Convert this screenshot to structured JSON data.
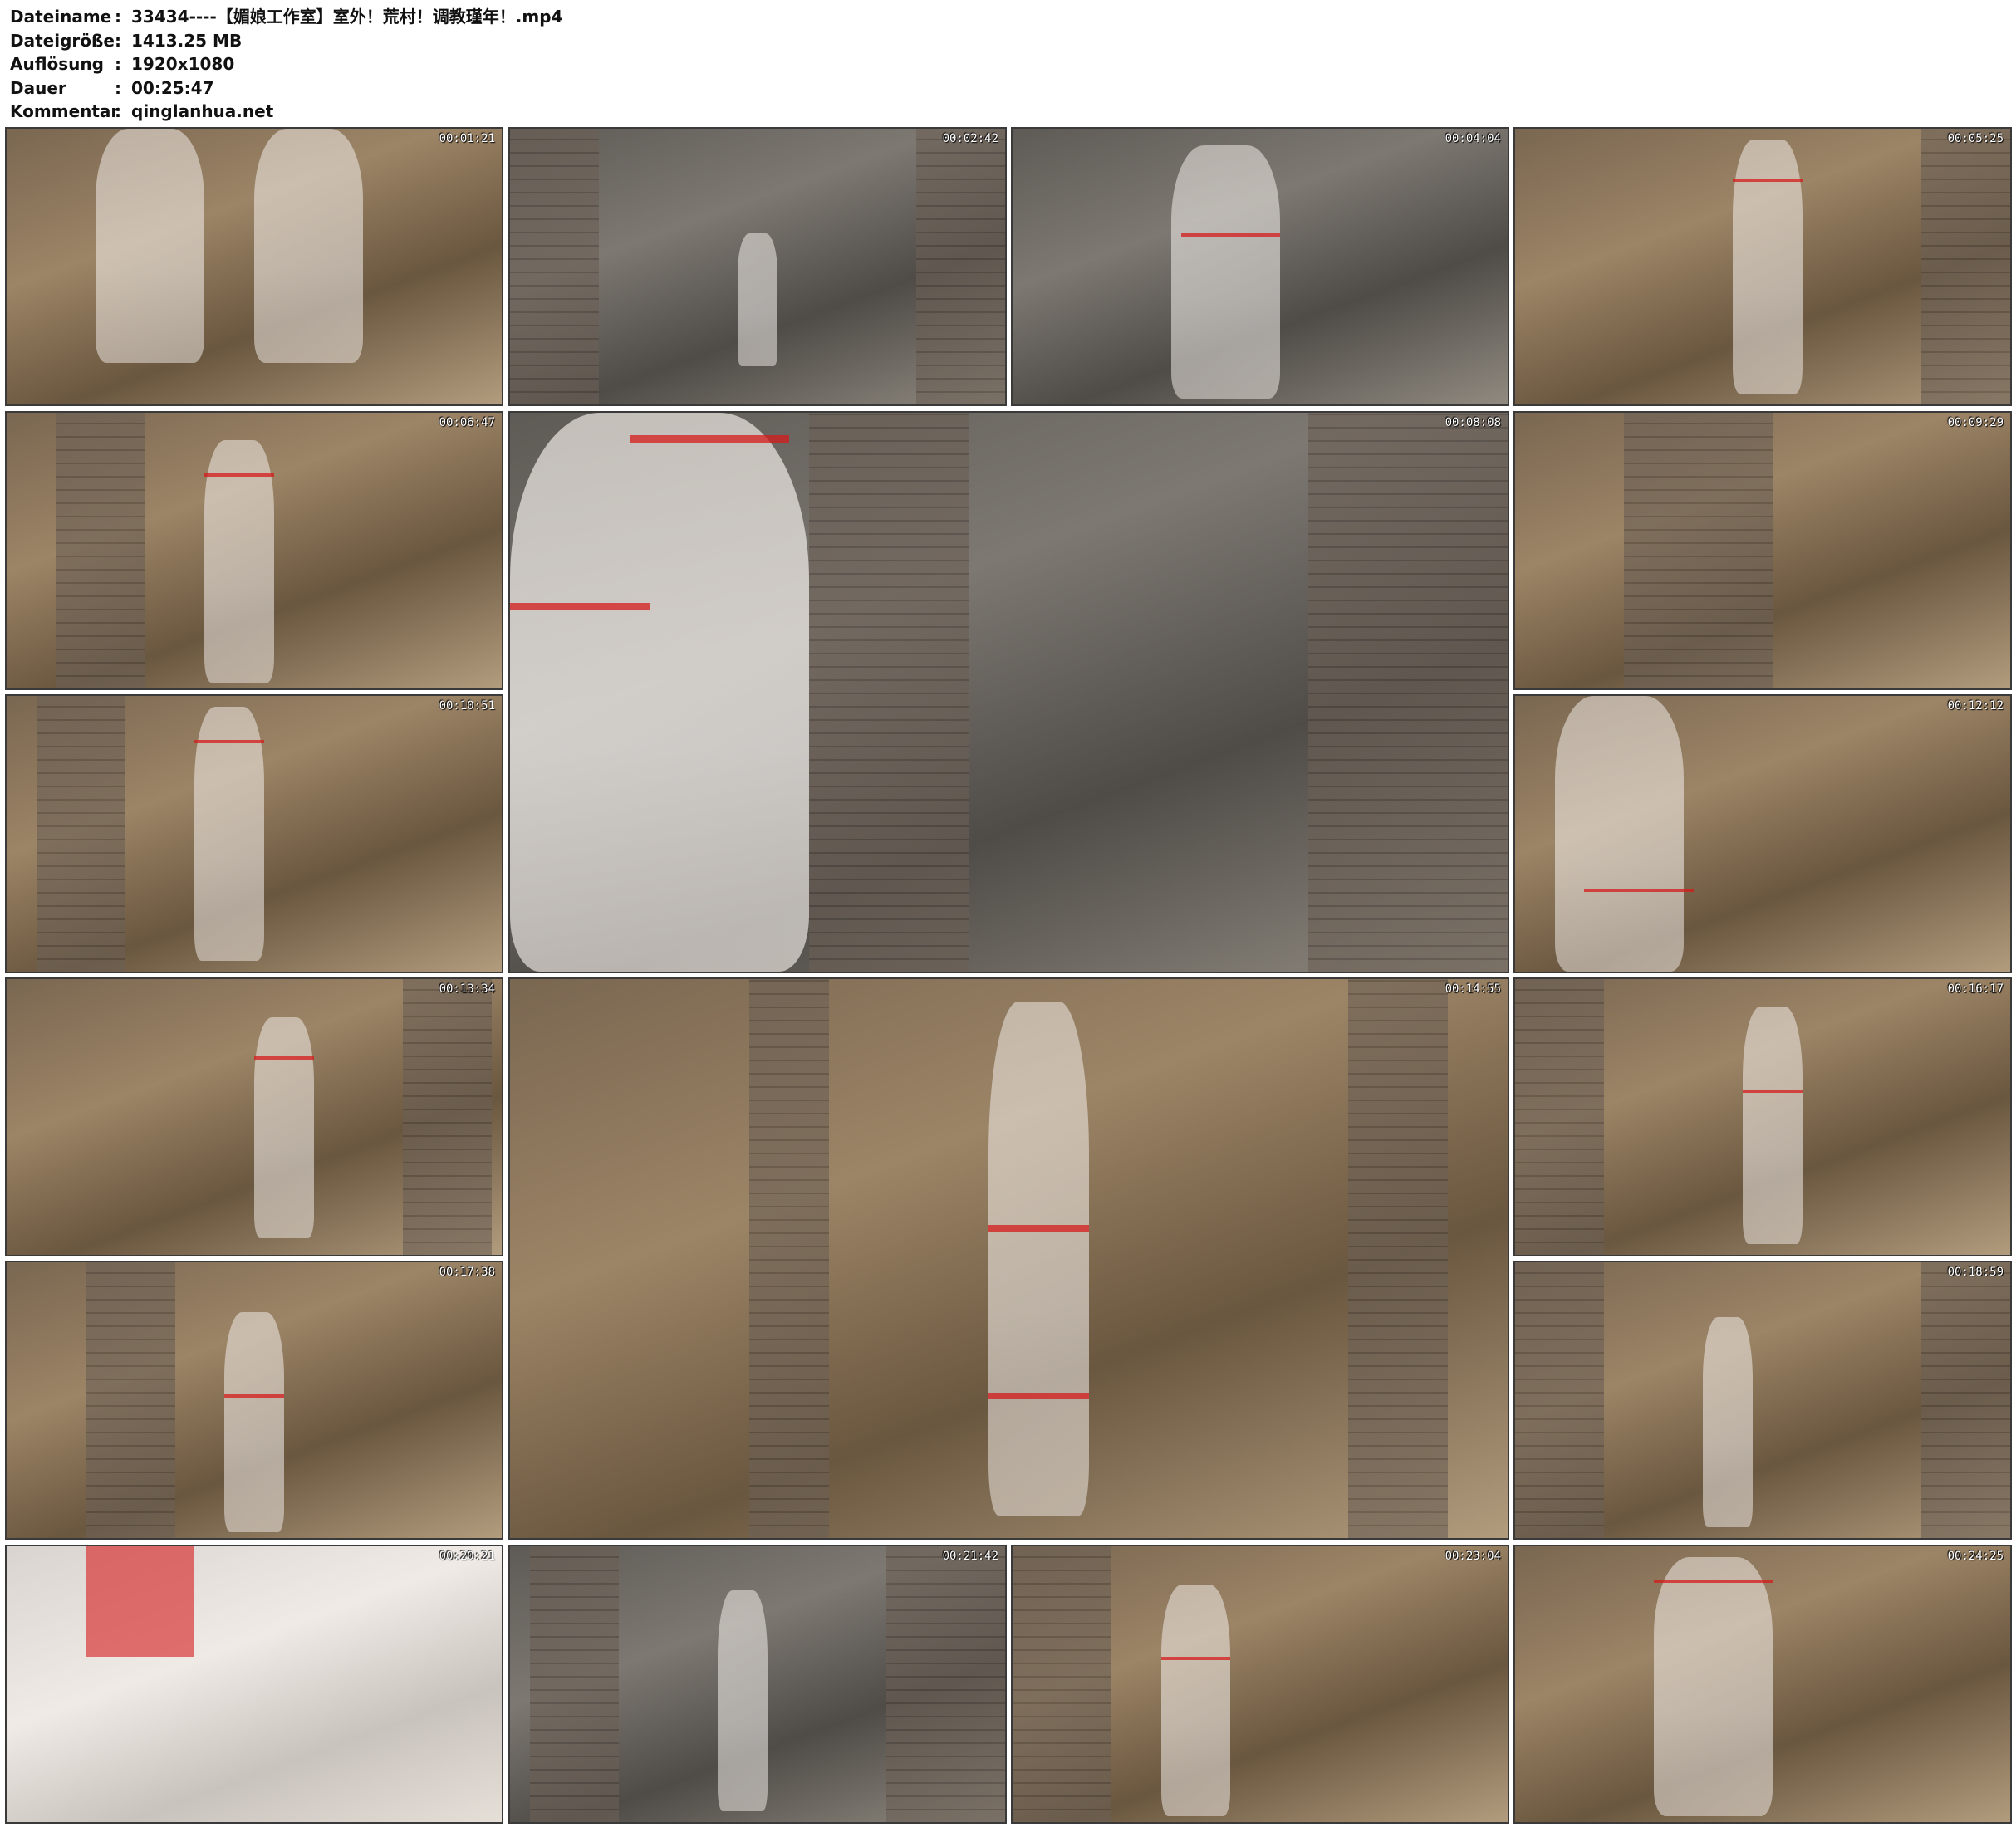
{
  "file_info": {
    "rows": [
      {
        "label": "Dateiname",
        "value": "33434----【媚娘工作室】室外！荒村！调教瑾年！.mp4"
      },
      {
        "label": "Dateigröße",
        "value": "1413.25 MB"
      },
      {
        "label": "Auflösung",
        "value": "1920x1080"
      },
      {
        "label": "Dauer",
        "value": "00:25:47"
      },
      {
        "label": "Kommentar",
        "value": "qinglanhua.net"
      }
    ]
  },
  "thumbnails": [
    {
      "timestamp": "00:01:21"
    },
    {
      "timestamp": "00:02:42"
    },
    {
      "timestamp": "00:04:04"
    },
    {
      "timestamp": "00:05:25"
    },
    {
      "timestamp": "00:06:47"
    },
    {
      "timestamp": "00:08:08"
    },
    {
      "timestamp": "00:09:29"
    },
    {
      "timestamp": "00:10:51"
    },
    {
      "timestamp": "00:12:12"
    },
    {
      "timestamp": "00:13:34"
    },
    {
      "timestamp": "00:14:55"
    },
    {
      "timestamp": "00:16:17"
    },
    {
      "timestamp": "00:17:38"
    },
    {
      "timestamp": "00:18:59"
    },
    {
      "timestamp": "00:20:21"
    },
    {
      "timestamp": "00:21:42"
    },
    {
      "timestamp": "00:23:04"
    },
    {
      "timestamp": "00:24:25"
    }
  ]
}
